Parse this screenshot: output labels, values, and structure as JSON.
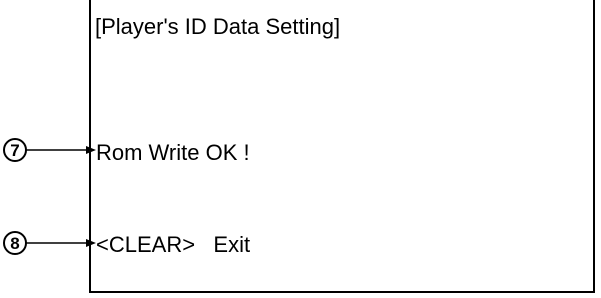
{
  "screen": {
    "title": "[Player's ID Data Setting]",
    "lines": [
      {
        "callout": "7",
        "text": "Rom Write OK !"
      },
      {
        "callout": "8",
        "text": "<CLEAR>   Exit"
      }
    ]
  }
}
